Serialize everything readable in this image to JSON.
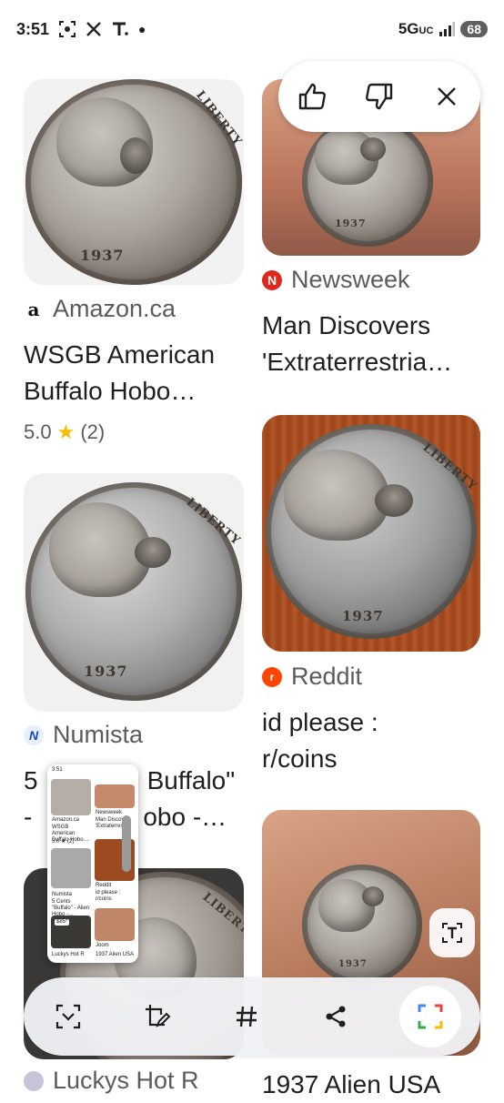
{
  "status_bar": {
    "time": "3:51",
    "icons_left": [
      "screenshot-icon",
      "x-icon",
      "t-icon",
      "dot-icon"
    ],
    "network": "5G",
    "network_sub": "UC",
    "battery": "68"
  },
  "feedback": {
    "thumbs_up_icon": "thumbs-up-icon",
    "thumbs_down_icon": "thumbs-down-icon",
    "close_icon": "close-icon"
  },
  "results": [
    {
      "source": "Amazon.ca",
      "source_icon": "a",
      "title_line1": "WSGB American",
      "title_line2": "Buffalo Hobo…",
      "rating": "5.0",
      "reviews": "(2)"
    },
    {
      "source": "Newsweek",
      "source_icon": "N",
      "title_line1": "Man Discovers",
      "title_line2": "'Extraterrestria…"
    },
    {
      "source": "Numista",
      "source_icon": "N",
      "title_line1": "5",
      "title_line1b": "Buffalo\"",
      "title_line2": "-",
      "title_line2b": "obo -…"
    },
    {
      "source": "Reddit",
      "source_icon": "r",
      "title_line1": "id please :",
      "title_line2": "r/coins"
    },
    {
      "source": "Luckys Hot R",
      "title_line1": "1937 Alien USA"
    }
  ],
  "coin_text": {
    "liberty": "LIBERTY",
    "year": "1937"
  },
  "mini_preview": {
    "time": "3:51",
    "src1": "Amazon.ca",
    "t1": "WSGB American Buffalo Hobo…",
    "rating": "5.0 ★ (2)",
    "src2": "Newsweek",
    "t2": "Man Discov… 'Extraterres…",
    "src3": "Numista",
    "t3": "5 Cents \"Buffalo\" - Alien Hobo -…",
    "src4": "Reddit",
    "t4": "id please : r/coins",
    "price": "$85*",
    "src5": "Joom",
    "src6": "Luckys Hot R",
    "t6": "1937 Alien USA"
  },
  "bottom_bar": {
    "items": [
      "scan-icon",
      "edit-image-icon",
      "hashtag-icon",
      "share-icon",
      "lens-icon"
    ]
  }
}
